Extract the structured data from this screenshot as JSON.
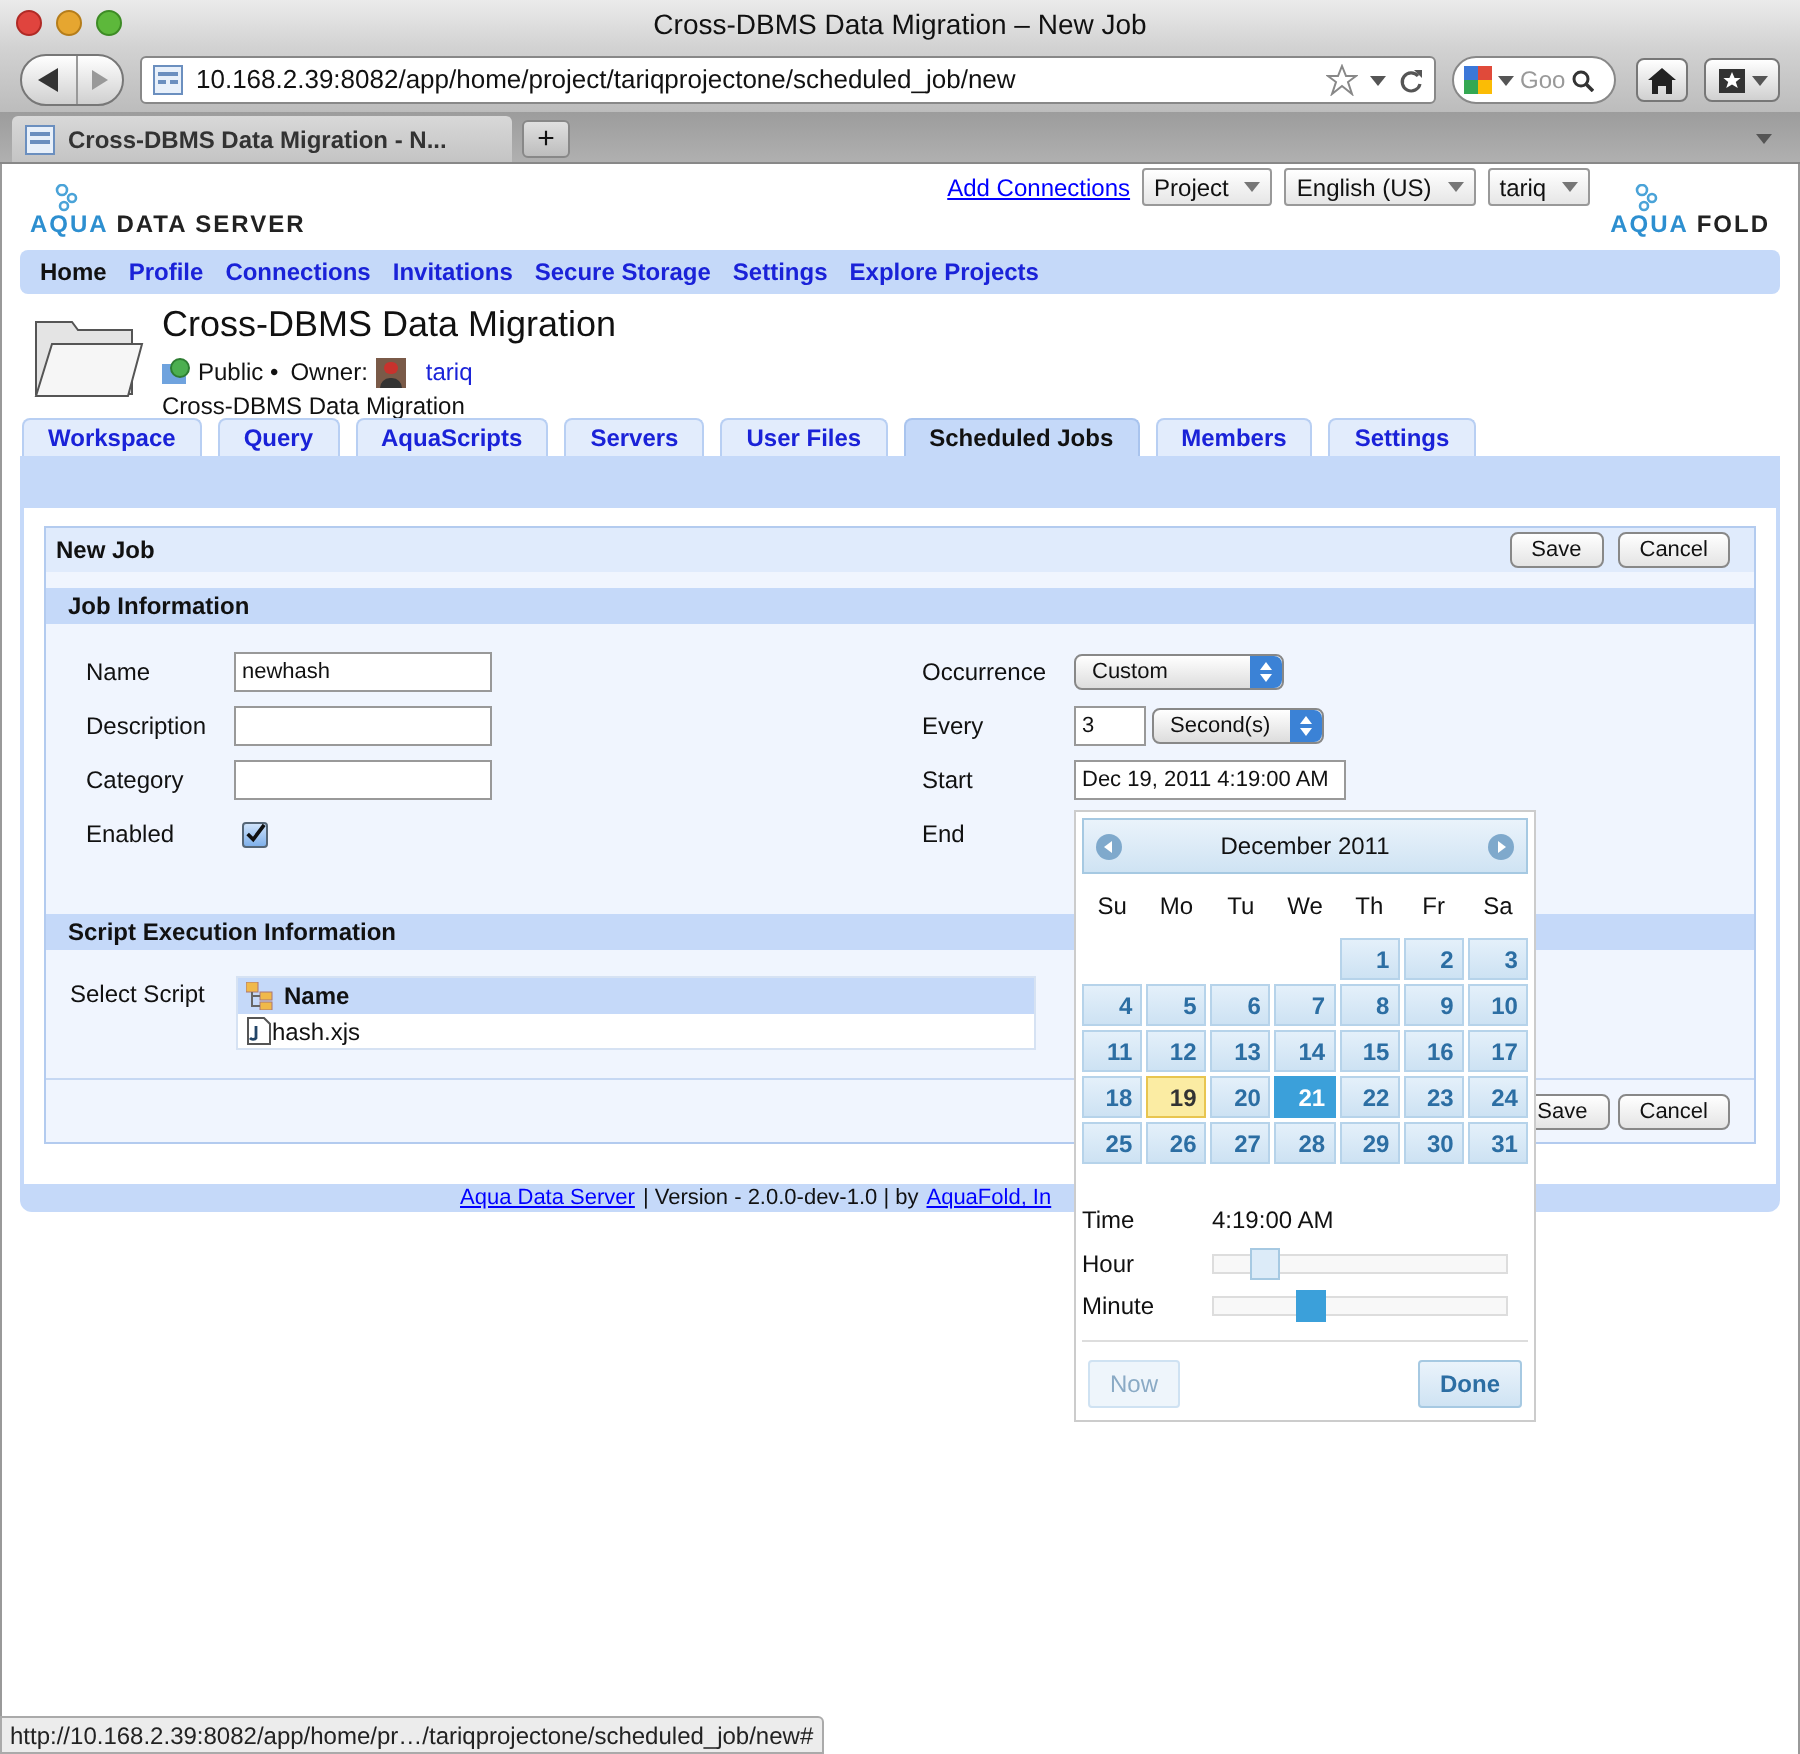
{
  "window": {
    "title": "Cross-DBMS Data Migration – New Job"
  },
  "toolbar": {
    "url": "10.168.2.39:8082/app/home/project/tariqprojectone/scheduled_job/new",
    "search_placeholder": "Goo"
  },
  "browser_tabs": [
    {
      "label": "Cross-DBMS Data Migration - N...",
      "selected": true
    }
  ],
  "new_tab_button": "+",
  "header": {
    "logo_left": {
      "accent": "AQUA",
      "rest": "DATA SERVER"
    },
    "add_connections": "Add Connections",
    "menus": [
      "Project",
      "English (US)",
      "tariq"
    ],
    "logo_right": {
      "accent": "AQUA",
      "rest": "FOLD"
    }
  },
  "nav": [
    {
      "label": "Home",
      "selected": true
    },
    {
      "label": "Profile",
      "selected": false
    },
    {
      "label": "Connections",
      "selected": false
    },
    {
      "label": "Invitations",
      "selected": false
    },
    {
      "label": "Secure Storage",
      "selected": false
    },
    {
      "label": "Settings",
      "selected": false
    },
    {
      "label": "Explore Projects",
      "selected": false
    }
  ],
  "project": {
    "title": "Cross-DBMS Data Migration",
    "visibility": "Public •",
    "owner_label": "Owner:",
    "owner": "tariq",
    "description": "Cross-DBMS Data Migration"
  },
  "tabs": [
    {
      "label": "Workspace",
      "selected": false
    },
    {
      "label": "Query",
      "selected": false
    },
    {
      "label": "AquaScripts",
      "selected": false
    },
    {
      "label": "Servers",
      "selected": false
    },
    {
      "label": "User Files",
      "selected": false
    },
    {
      "label": "Scheduled Jobs",
      "selected": true
    },
    {
      "label": "Members",
      "selected": false
    },
    {
      "label": "Settings",
      "selected": false
    }
  ],
  "job": {
    "title": "New Job",
    "buttons": [
      "Save",
      "Cancel"
    ],
    "section_job": "Job Information",
    "left_fields": [
      {
        "label": "Name",
        "kind": "text",
        "value": "newhash"
      },
      {
        "label": "Description",
        "kind": "text"
      },
      {
        "label": "Category",
        "kind": "text"
      },
      {
        "label": "Enabled",
        "kind": "checkbox",
        "checked": true
      }
    ],
    "right_fields": [
      {
        "label": "Occurrence",
        "kind": "select",
        "value": "Custom"
      },
      {
        "label": "Every",
        "kind": "number_unit",
        "value": "3",
        "unit": "Second(s)"
      },
      {
        "label": "Start",
        "kind": "text",
        "value": "Dec 19, 2011 4:19:00 AM"
      },
      {
        "label": "End",
        "kind": "hidden"
      }
    ],
    "section_script": "Script Execution Information",
    "select_script_label": "Select Script",
    "script_table": {
      "column": "Name",
      "rows": [
        "hash.xjs"
      ]
    },
    "bottom_buttons": [
      "Save",
      "Cancel"
    ]
  },
  "footer": {
    "link1": "Aqua Data Server",
    "middle": "| Version - 2.0.0-dev-1.0 | by",
    "link2": "AquaFold, In"
  },
  "datepicker": {
    "month": "December 2011",
    "weekdays": [
      "Su",
      "Mo",
      "Tu",
      "We",
      "Th",
      "Fr",
      "Sa"
    ],
    "weeks": [
      [
        {
          "day": "1",
          "today": false,
          "selected": false
        },
        {
          "day": "2",
          "today": false,
          "selected": false
        },
        {
          "day": "3",
          "today": false,
          "selected": false
        }
      ],
      [
        {
          "day": "4",
          "today": false,
          "selected": false
        },
        {
          "day": "5",
          "today": false,
          "selected": false
        },
        {
          "day": "6",
          "today": false,
          "selected": false
        },
        {
          "day": "7",
          "today": false,
          "selected": false
        },
        {
          "day": "8",
          "today": false,
          "selected": false
        },
        {
          "day": "9",
          "today": false,
          "selected": false
        },
        {
          "day": "10",
          "today": false,
          "selected": false
        }
      ],
      [
        {
          "day": "11",
          "today": false,
          "selected": false
        },
        {
          "day": "12",
          "today": false,
          "selected": false
        },
        {
          "day": "13",
          "today": false,
          "selected": false
        },
        {
          "day": "14",
          "today": false,
          "selected": false
        },
        {
          "day": "15",
          "today": false,
          "selected": false
        },
        {
          "day": "16",
          "today": false,
          "selected": false
        },
        {
          "day": "17",
          "today": false,
          "selected": false
        }
      ],
      [
        {
          "day": "18",
          "today": false,
          "selected": false
        },
        {
          "day": "19",
          "today": true,
          "selected": false
        },
        {
          "day": "20",
          "today": false,
          "selected": false
        },
        {
          "day": "21",
          "today": false,
          "selected": true
        },
        {
          "day": "22",
          "today": false,
          "selected": false
        },
        {
          "day": "23",
          "today": false,
          "selected": false
        },
        {
          "day": "24",
          "today": false,
          "selected": false
        }
      ],
      [
        {
          "day": "25",
          "today": false,
          "selected": false
        },
        {
          "day": "26",
          "today": false,
          "selected": false
        },
        {
          "day": "27",
          "today": false,
          "selected": false
        },
        {
          "day": "28",
          "today": false,
          "selected": false
        },
        {
          "day": "29",
          "today": false,
          "selected": false
        },
        {
          "day": "30",
          "today": false,
          "selected": false
        },
        {
          "day": "31",
          "today": false,
          "selected": false
        }
      ]
    ],
    "time_label": "Time",
    "time_value": "4:19:00 AM",
    "sliders": [
      {
        "label": "Hour",
        "level": 0.17,
        "active": false
      },
      {
        "label": "Minute",
        "level": 0.33,
        "active": true
      }
    ],
    "now_button": {
      "label": "Now",
      "disabled": true
    },
    "done_button": "Done"
  },
  "status_bar": "http://10.168.2.39:8082/app/home/pr…/tariqprojectone/scheduled_job/new#"
}
